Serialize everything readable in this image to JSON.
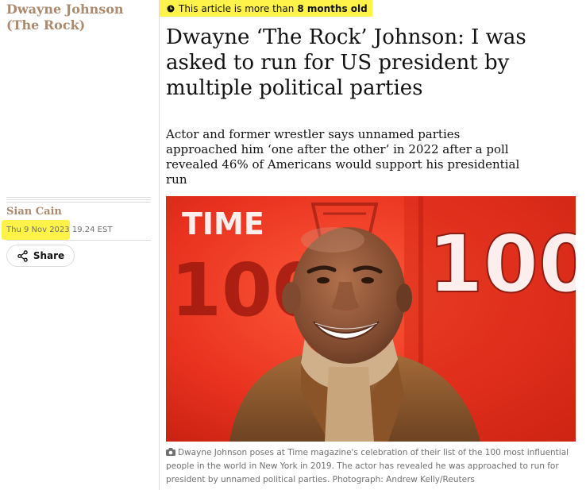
{
  "sidebar": {
    "section_link": "Dwayne Johnson (The Rock)",
    "author": "Sian Cain",
    "date": "Thu 9 Nov 2023",
    "time": "19.24 EST",
    "share_label": "Share"
  },
  "notice": {
    "prefix": "This article is more than",
    "age": "8 months old"
  },
  "article": {
    "headline": "Dwayne ‘The Rock’ Johnson: I was asked to run for US president by multiple political parties",
    "standfirst": "Actor and former wrestler says unnamed parties approached him ‘one after the other’ in 2022 after a poll revealed 46% of Americans would support his presidential run",
    "image": {
      "backdrop_text_left_top": "TIME",
      "backdrop_text_left_number": "100",
      "backdrop_text_right_number": "100"
    },
    "caption": "Dwayne Johnson poses at Time magazine's celebration of their list of the 100 most influential people in the world in New York in 2019. The actor has revealed he was approached to run for president by unnamed political parties. Photograph: Andrew Kelly/Reuters"
  },
  "colors": {
    "highlight": "#fff34a",
    "section_brown": "#ab8a6e",
    "text": "#121212",
    "muted": "#707070",
    "backdrop_red": "#e8321f"
  },
  "icons": [
    "clock-icon",
    "share-icon",
    "camera-icon"
  ]
}
